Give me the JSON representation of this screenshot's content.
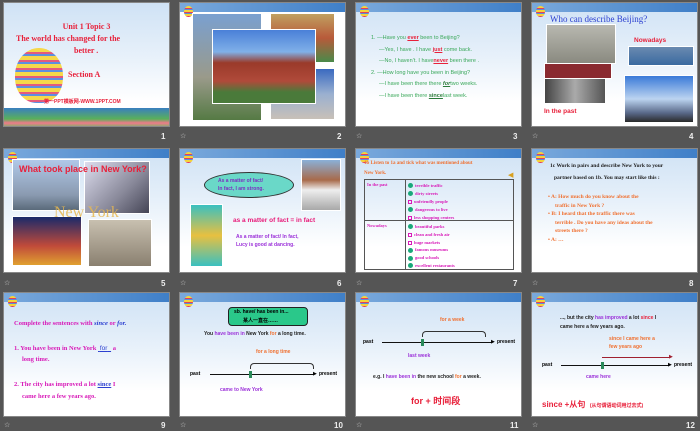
{
  "slides": [
    {
      "num": "1",
      "title1": "Unit 1 Topic 3",
      "title2": "The world  has changed for the",
      "title3": "better .",
      "section": "Section A",
      "watermark": "第一PPT模板网-WWW.1PPT.COM"
    },
    {
      "num": "2"
    },
    {
      "num": "3",
      "l1a": "1. —Have you",
      "l1b": "ever",
      "l1c": "been to Beijing?",
      "l2a": "—Yes, I have . I have",
      "l2b": "just",
      "l2c": "come back.",
      "l3a": "—No, I haven’t. I have",
      "l3b": "never",
      "l3c": "been there .",
      "l4": "2. —How long have you been in Beijing?",
      "l5a": "—I have been there there",
      "l5b": "for",
      "l5c": "two weeks.",
      "l6a": "—I have been there",
      "l6b": "since",
      "l6c": "last week."
    },
    {
      "num": "4",
      "title": "Who can describe Beijing?",
      "nowadays": "Nowadays",
      "past": "In the past"
    },
    {
      "num": "5",
      "title": "What took place in New York?",
      "overlay": "New York"
    },
    {
      "num": "6",
      "bubble1": "As a matter of fact/",
      "bubble2": "In fact, I am strong.",
      "eq": "as a matter of fact = in fact",
      "ex1": "As a matter of fact/ In fact,",
      "ex2": "Lucy is good at dancing."
    },
    {
      "num": "7",
      "title1": "1b Listen to 1a and tick what was mentioned about",
      "title2": "New York.",
      "row1": "In the past",
      "row2": "Nowadays",
      "items1": [
        "terrible traffic",
        "dirty streets",
        "unfriendly people",
        "dangerous to live",
        "less shopping centers"
      ],
      "items2": [
        "beautiful parks",
        "clean and fresh air",
        "huge markets",
        "famous museums",
        "good schools",
        "excellent restaurants"
      ]
    },
    {
      "num": "8",
      "title1": "1c Work in pairs and describe New York to your",
      "title2": "partner based on 1b. You may start like this :",
      "a1": "A: How  much  do  you  know  about  the",
      "a1b": "traffic in New York ?",
      "b1": "B: I heard  that  the  traffic  there  was",
      "b1b": "terrible . Do  you  have  any  ideas  about  the",
      "b1c": "streets there ?",
      "a2": "A: …"
    },
    {
      "num": "9",
      "title_a": "Complete the sentences with",
      "since": "since",
      "or": "or",
      "for": "for.",
      "s1a": "1. You have been in New York",
      "s1b": "for",
      "s1c": "a",
      "s1d": "long time.",
      "s2a": "2. The city has improved a lot",
      "s2b": "since",
      "s2c": "I",
      "s2d": "came here a few  years ago."
    },
    {
      "num": "10",
      "bubble1": "sb. have/ has been in...",
      "bubble2": "某人一直在……",
      "s_a": "You",
      "s_b": "have been in",
      "s_c": "New York",
      "s_d": "for",
      "s_e": "a long time.",
      "brace": "for a long time",
      "past": "past",
      "present": "present",
      "came": "came to New York"
    },
    {
      "num": "11",
      "brace": "for a week",
      "past": "past",
      "present": "present",
      "last": "last week",
      "eg_a": "e.g. I",
      "eg_b": "have been in",
      "eg_c": "the new school",
      "eg_d": "for",
      "eg_e": "a week.",
      "rule": "for + 时间段"
    },
    {
      "num": "12",
      "s1a": "..., but the city",
      "s1b": "has improved",
      "s1c": "a lot",
      "s1d": "since",
      "s1e": "I",
      "s2": "came here a few years ago.",
      "arrow1": "since I  came here a",
      "arrow2": "few years ago",
      "past": "past",
      "present": "present",
      "came": "came here",
      "rule": "since +从句",
      "note": "(从句谓语动词用过去式)"
    }
  ],
  "colors": {
    "red": "#e8203a",
    "green": "#3aa85a",
    "purple": "#9b30d9",
    "orange": "#f07030",
    "magenta": "#d81ab8",
    "blue": "#2b3fd0"
  }
}
